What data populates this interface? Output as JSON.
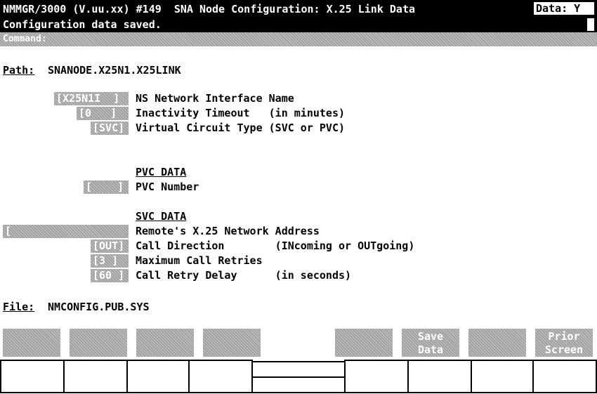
{
  "header": {
    "title": "NMMGR/3000 (V.uu.xx) #149  SNA Node Configuration: X.25 Link Data",
    "data_flag": "Data: Y"
  },
  "message": "Configuration data saved.",
  "command": {
    "label": "Command:",
    "value": ""
  },
  "path": {
    "label": "Path:",
    "value": "SNANODE.X25N1.X25LINK"
  },
  "fields": {
    "ns_interface": {
      "value": "X25N1I  ",
      "label": "NS Network Interface Name"
    },
    "inactivity": {
      "value": "0   ",
      "label": "Inactivity Timeout   (in minutes)"
    },
    "vc_type": {
      "value": "SVC",
      "label": "Virtual Circuit Type (SVC or PVC)"
    },
    "pvc_header": "PVC DATA",
    "pvc_number": {
      "value": "    ",
      "label": "PVC Number"
    },
    "svc_header": "SVC DATA",
    "remote_addr": {
      "value": "",
      "label": "Remote's X.25 Network Address"
    },
    "call_direction": {
      "value": "OUT",
      "label": "Call Direction        (INcoming or OUTgoing)"
    },
    "max_retries": {
      "value": "3 ",
      "label": "Maximum Call Retries"
    },
    "retry_delay": {
      "value": "60 ",
      "label": "Call Retry Delay      (in seconds)"
    }
  },
  "file": {
    "label": "File:",
    "value": "NMCONFIG.PUB.SYS"
  },
  "function_keys": [
    {
      "line1": "",
      "line2": ""
    },
    {
      "line1": "",
      "line2": ""
    },
    {
      "line1": "",
      "line2": ""
    },
    {
      "line1": "",
      "line2": ""
    },
    {
      "line1": "",
      "line2": ""
    },
    {
      "line1": "Save",
      "line2": "Data"
    },
    {
      "line1": "",
      "line2": ""
    },
    {
      "line1": "Prior",
      "line2": "Screen"
    }
  ]
}
